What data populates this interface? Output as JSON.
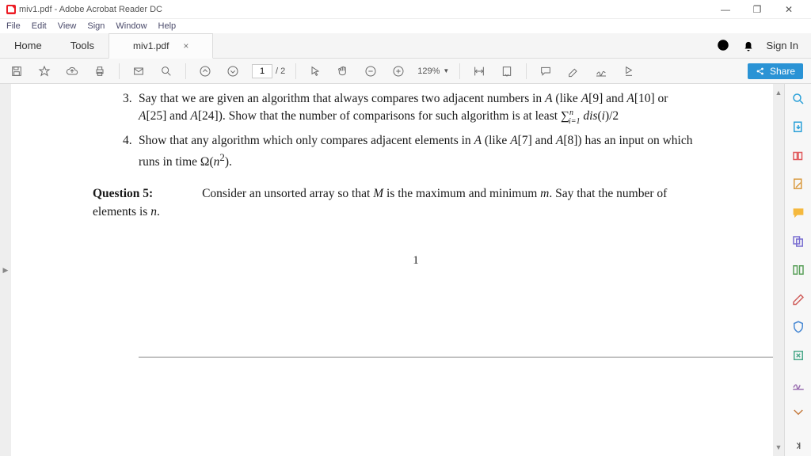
{
  "window": {
    "title": "miv1.pdf - Adobe Acrobat Reader DC"
  },
  "menu": {
    "file": "File",
    "edit": "Edit",
    "view": "View",
    "sign": "Sign",
    "window": "Window",
    "help": "Help"
  },
  "tabs": {
    "home": "Home",
    "tools": "Tools",
    "doc": "miv1.pdf",
    "signin": "Sign In"
  },
  "toolbar": {
    "current_page": "1",
    "total_pages": "/ 2",
    "zoom": "129%",
    "share": "Share"
  },
  "doc": {
    "item3": "Say that we are given an algorithm that always compares two adjacent numbers in A (like A[9] and A[10] or A[25] and A[24]). Show that the number of comparisons for such algorithm is at least Σⁿᵢ₌₁ dis(i)/2",
    "item4": "Show that any algorithm which only compares adjacent elements in A (like A[7] and A[8]) has an input on which runs in time Ω(n²).",
    "q5_label": "Question 5:",
    "q5_body": " Consider an unsorted array so that M is the maximum and minimum m. Say that the number of elements is n.",
    "page_number": "1"
  }
}
